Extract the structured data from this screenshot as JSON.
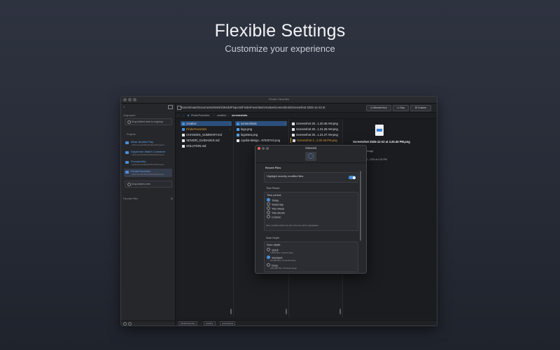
{
  "hero": {
    "title": "Flexible Settings",
    "subtitle": "Customize your experience"
  },
  "window": {
    "title": "Finder Favorites",
    "path": "/Users/main/Documents/Work/GitHub/Projects/FinderFavorites/creative/screenshots/Screenshot 2025-12-22 at",
    "buttons": {
      "minute_hour": "Minute/Hour",
      "day": "Day",
      "custom": "Custom"
    },
    "breadcrumb": [
      "FinderFavorites",
      "creative",
      "screenshots"
    ]
  },
  "sidebar": {
    "ungrouped_label": "Ungrouped",
    "drop_ungroup": "Drop folders here to ungroup",
    "projects_label": "Projects",
    "projects": [
      {
        "name": "Wear Bubble Play",
        "path": "~/Documents/Work/GitHub/Projects"
      },
      {
        "name": "Daydream Watch Container",
        "path": "~/Documents/Work/GitHub/Projects"
      },
      {
        "name": "FocusLimits",
        "path": "~/Documents/Work/GitHub/Projects"
      },
      {
        "name": "FinderFavorites",
        "path": "~/Documents/Work/GitHub/Projects"
      }
    ],
    "drop_here": "Drop folders here",
    "favorite_files_label": "Favorite Files"
  },
  "columns": {
    "col1": [
      {
        "name": "creative",
        "type": "folder",
        "selected": true,
        "chevron": true
      },
      {
        "name": "FinderFavorites",
        "type": "folder",
        "selected": false,
        "chevron": true
      },
      {
        "name": "CHANGES_SUMMARY.md",
        "type": "file",
        "selected": false
      },
      {
        "name": "SENIOR_GUIDANCE.md",
        "type": "file",
        "selected": false
      },
      {
        "name": "SOLUTION.md",
        "type": "file",
        "selected": false
      }
    ],
    "col2": [
      {
        "name": "screenshots",
        "type": "folder",
        "selected": true,
        "chevron": true
      },
      {
        "name": "logo.png",
        "type": "img",
        "selected": false
      },
      {
        "name": "logoNew.png",
        "type": "img",
        "selected": false
      },
      {
        "name": "copilot-design...97630743.png",
        "type": "file",
        "selected": false
      }
    ],
    "col3": [
      {
        "name": "Screenshot 20...1.30.48 AM.png",
        "type": "file"
      },
      {
        "name": "Screenshot 20...1.31.28 AM.png",
        "type": "file"
      },
      {
        "name": "Screenshot 20...1.31.37 AM.png",
        "type": "file"
      },
      {
        "name": "Screenshot 2...3.20.49 PM.png",
        "type": "file"
      }
    ]
  },
  "preview": {
    "name": "Screenshot 2025-12-22 at 3.20.49 PM.png",
    "meta1": "Image",
    "meta2": "2, 2025 at 3:20 PM"
  },
  "statusbar": [
    "FinderFavorites",
    "creative",
    "screenshots"
  ],
  "dialog": {
    "title": "General",
    "section_recent": "Recent Files",
    "highlight_label": "Highlight recently modified files",
    "time_period_section": "Time Period",
    "time_period_label": "Time period:",
    "time_options": [
      "Today",
      "Yesterday",
      "This Week",
      "This Month",
      "Custom"
    ],
    "time_selected": 0,
    "time_hint": "Files modified within the last 24 hours will be highlighted",
    "scan_section": "Scan Depth",
    "scan_label": "Scan depth:",
    "scan_options": [
      {
        "name": "Quick",
        "desc": "1,000 files, 3 levels deep"
      },
      {
        "name": "Standard",
        "desc": "10,000 files, 10 levels deep"
      },
      {
        "name": "Deep",
        "desc": "100,000 files, 25 levels deep"
      }
    ],
    "scan_selected": 1
  },
  "colors": {
    "accent": "#4a90d9",
    "selection": "#2c4f7c",
    "close": "#ed6a5e",
    "minimize": "#5a5c62",
    "folder_text": "#e0a23a"
  }
}
